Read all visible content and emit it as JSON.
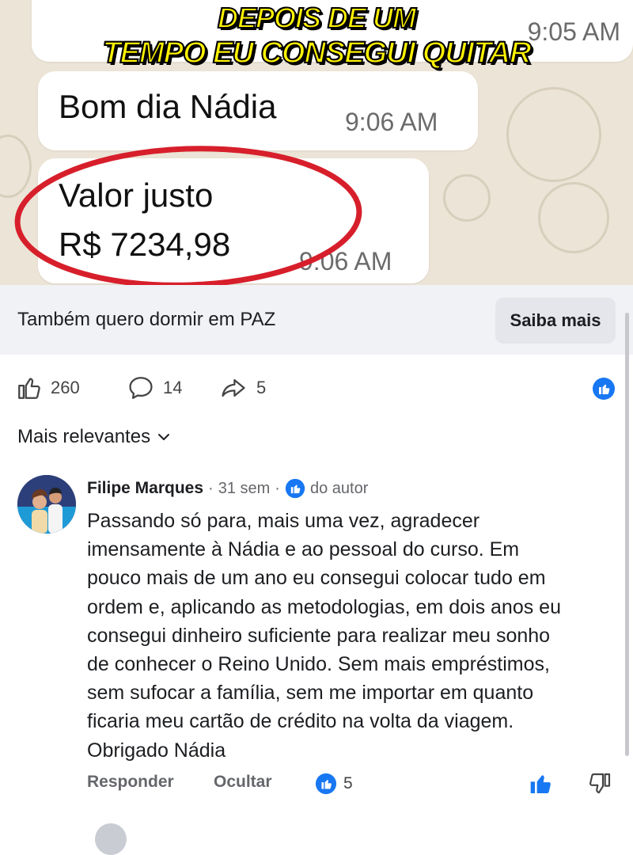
{
  "image_post": {
    "headline_line1": "DEPOIS DE UM",
    "headline_line2": "TEMPO EU CONSEGUI QUITAR",
    "top_time": "9:05 AM",
    "message1": {
      "text": "Bom dia Nádia",
      "time": "9:06 AM"
    },
    "message2": {
      "line1": "Valor justo",
      "line2": "R$ 7234,98",
      "time": "9:06 AM"
    }
  },
  "ad": {
    "text": "Também quero dormir em PAZ",
    "button": "Saiba mais"
  },
  "stats": {
    "likes": "260",
    "comments": "14",
    "shares": "5",
    "like_icon": "thumbs-up-icon",
    "comment_icon": "comment-bubble-icon",
    "share_icon": "share-arrow-icon"
  },
  "sort": {
    "label": "Mais relevantes",
    "icon": "chevron-down-icon"
  },
  "comment": {
    "author": "Filipe Marques",
    "age": "31 sem",
    "author_badge": "do autor",
    "lines": [
      "Passando só para, mais uma vez, agradecer",
      "imensamente à Nádia e ao pessoal do curso. Em",
      "pouco mais de um ano eu consegui colocar tudo em",
      "ordem e, aplicando as metodologias, em dois anos eu",
      "consegui dinheiro suficiente para realizar meu sonho",
      "de conhecer o Reino Unido. Sem mais empréstimos,",
      "sem sufocar a família, sem me importar em quanto",
      "ficaria meu cartão de crédito na volta da viagem.",
      "Obrigado Nádia"
    ],
    "actions": {
      "reply": "Responder",
      "hide": "Ocultar",
      "likes": "5"
    }
  },
  "colors": {
    "fb_blue": "#1877f2",
    "red_circle": "#d71f2b",
    "headline_yellow": "#fff200"
  }
}
